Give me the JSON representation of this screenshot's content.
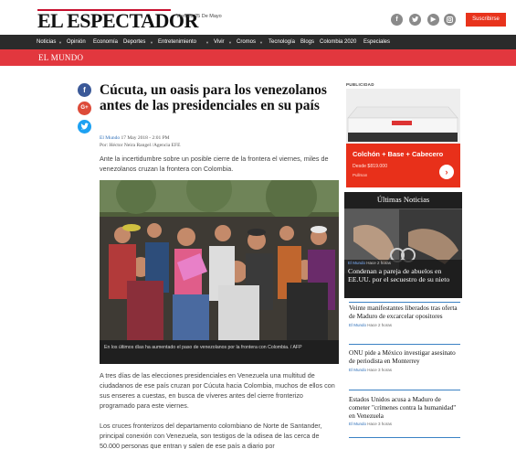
{
  "header": {
    "logo": "EL ESPECTADOR",
    "date": "Viernes 25 De Mayo",
    "social_icons": [
      "facebook-icon",
      "twitter-icon",
      "youtube-icon",
      "instagram-icon"
    ],
    "subscribe_label": "Suscribirse"
  },
  "nav": {
    "items": [
      "Noticias",
      "Opinión",
      "Economía",
      "Deportes",
      "Entretenimiento",
      "Vivir",
      "Cromos",
      "Tecnología",
      "Blogs",
      "Colombia 2020",
      "Especiales"
    ]
  },
  "section": {
    "title": "EL MUNDO"
  },
  "share": {
    "icons": [
      "facebook-icon",
      "google-plus-icon",
      "twitter-icon"
    ],
    "colors": [
      "#3b5998",
      "#dd4b39",
      "#1da1f2"
    ]
  },
  "article": {
    "headline": "Cúcuta, un oasis para los venezolanos antes de las presidenciales en su país",
    "section": "El Mundo",
    "date": "17 May 2018 - 2:01 PM",
    "author": "Por: Héctor Neira Rangel /Agencia EFE",
    "lead": "Ante la incertidumbre sobre un posible cierre de la frontera el viernes, miles de venezolanos cruzan la frontera con Colombia.",
    "caption": "En los últimos días ha aumentado el paso de venezolanos por la frontera con Colombia. / AFP",
    "paragraphs": [
      "A tres días de las elecciones presidenciales en Venezuela una multitud de ciudadanos de ese país cruzan por Cúcuta hacia Colombia, muchos de ellos con sus enseres a cuestas, en busca de víveres antes del cierre fronterizo programado para este viernes.",
      "Los cruces fronterizos del departamento colombiano de Norte de Santander, principal conexión con Venezuela, son testigos de la odisea de las cerca de 50.000 personas que entran y salen de ese país a diario por"
    ]
  },
  "sidebar": {
    "ad": {
      "label": "PUBLICIDAD",
      "title": "Colchón + Base + Cabecero",
      "price": "Desde $819.000",
      "brand": "Pullman",
      "arrow": "›"
    },
    "ultimas": {
      "title": "Últimas Noticias",
      "featured": {
        "section": "El Mundo",
        "time": "Hace 2 horas",
        "headline": "Condenan a pareja de abuelos en EE.UU. por el secuestro de su nieto"
      },
      "items": [
        {
          "title": "Veinte manifestantes liberados tras oferta de Maduro de excarcelar opositores",
          "section": "El Mundo",
          "time": "Hace 2 horas"
        },
        {
          "title": "ONU pide a México investigar asesinato de periodista en Monterrey",
          "section": "El Mundo",
          "time": "Hace 3 horas"
        },
        {
          "title": "Estados Unidos acusa a Maduro de cometer \"crímenes contra la humanidad\" en Venezuela",
          "section": "El Mundo",
          "time": "Hace 3 horas"
        }
      ]
    }
  }
}
